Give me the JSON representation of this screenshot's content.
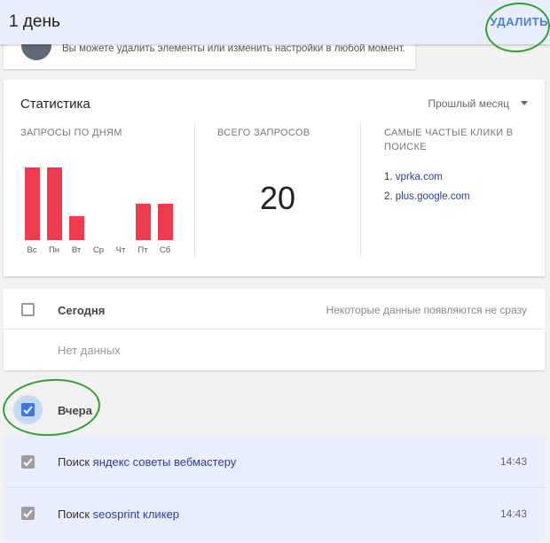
{
  "header": {
    "title": "1 день",
    "delete_label": "УДАЛИТЬ"
  },
  "notice": {
    "text": "Вы можете удалить элементы или изменить настройки в любой момент."
  },
  "stats": {
    "title": "Статистика",
    "period": "Прошлый месяц",
    "by_day_label": "ЗАПРОСЫ ПО ДНЯМ",
    "total_label": "ВСЕГО ЗАПРОСОВ",
    "total_value": "20",
    "top_clicks_label_1": "САМЫЕ ЧАСТЫЕ КЛИКИ В",
    "top_clicks_label_2": "ПОИСКЕ",
    "top_clicks": [
      {
        "num": "1.",
        "site": "vprka.com"
      },
      {
        "num": "2.",
        "site": "plus.google.com"
      }
    ]
  },
  "chart_data": {
    "type": "bar",
    "categories": [
      "Вс",
      "Пн",
      "Вт",
      "Ср",
      "Чт",
      "Пт",
      "Сб"
    ],
    "values": [
      6,
      6,
      2,
      0,
      0,
      3,
      3
    ],
    "ylim": [
      0,
      6
    ],
    "color": "#f03a4e"
  },
  "today": {
    "label": "Сегодня",
    "note": "Некоторые данные появляются не сразу",
    "empty": "Нет данных"
  },
  "yesterday": {
    "label": "Вчера",
    "items": [
      {
        "prefix": "Поиск",
        "query": "яндекс советы вебмастеру",
        "time": "14:43"
      },
      {
        "prefix": "Поиск",
        "query": "seosprint кликер",
        "time": "14:43"
      }
    ]
  },
  "colors": {
    "accent": "#4a7fd6",
    "bar": "#f03a4e",
    "link": "#2b3e9a",
    "annotation": "#2fa12f"
  }
}
